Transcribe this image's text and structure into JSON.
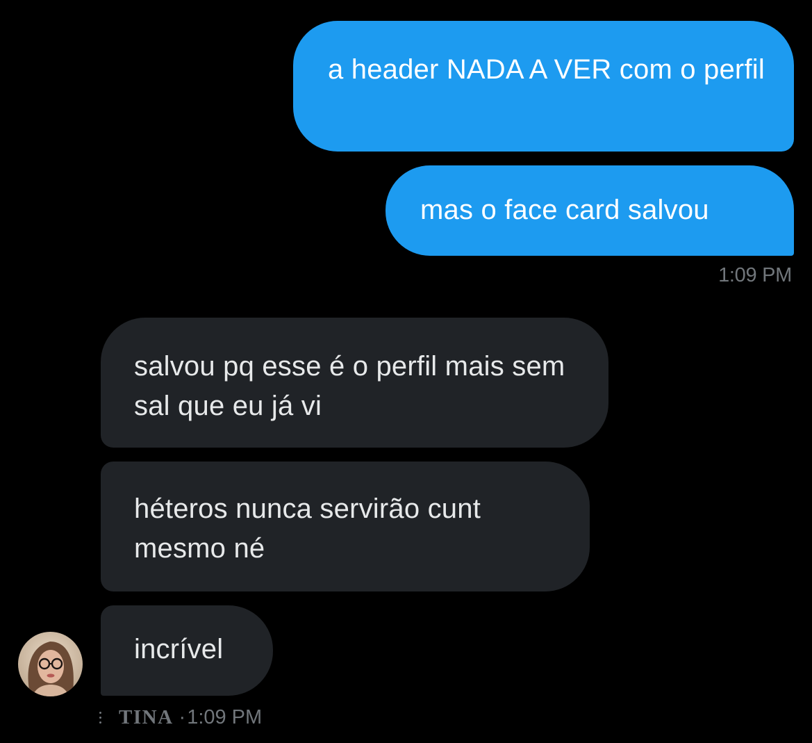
{
  "conversation": {
    "sent_messages": [
      "a header NADA A VER com o perfil",
      "mas o face card salvou"
    ],
    "sent_time": "1:09 PM",
    "received_messages": [
      "salvou pq esse é o perfil mais sem sal que eu já vi",
      "héteros nunca servirão cunt mesmo né",
      "incrível"
    ],
    "sender_name": "TINA",
    "separator": "·",
    "received_time": "1:09 PM"
  },
  "colors": {
    "background": "#000000",
    "sent_bubble": "#1d9bf0",
    "received_bubble": "#202327",
    "timestamp": "#71767b"
  },
  "icons": {
    "more_options": "vertical-dots-icon",
    "avatar": "user-avatar-photo"
  }
}
